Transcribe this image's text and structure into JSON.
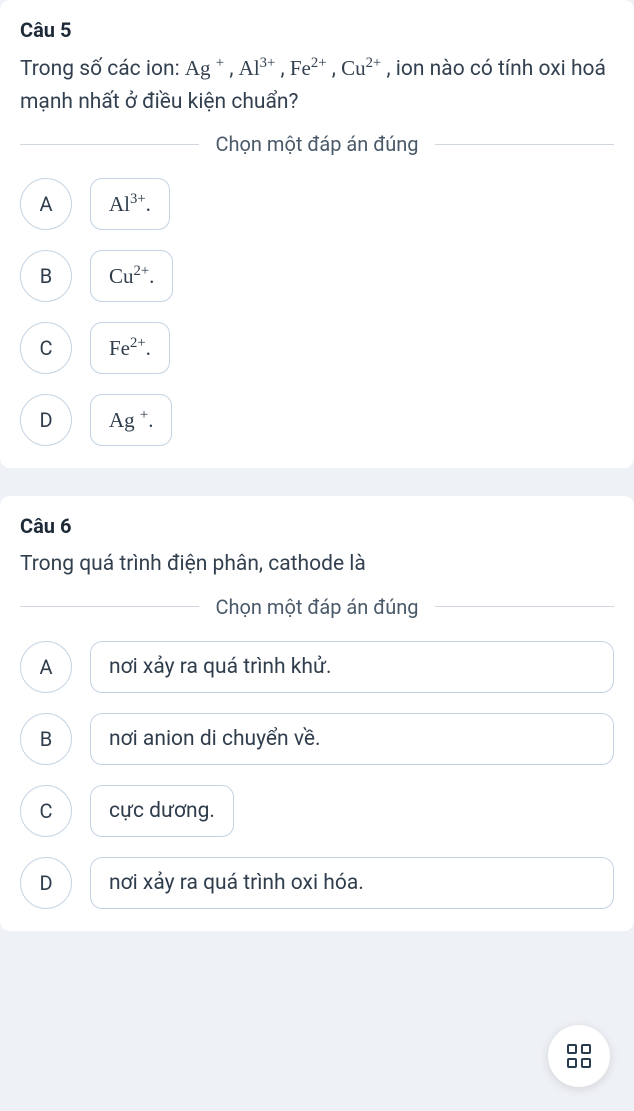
{
  "q5": {
    "title": "Câu 5",
    "stem_prefix": "Trong số các ion: ",
    "stem_suffix": ", ion nào có tính oxi hoá mạnh nhất ở điều kiện chuẩn?",
    "ions": [
      {
        "base": "Ag",
        "charge": "+"
      },
      {
        "base": "Al",
        "charge": "3+"
      },
      {
        "base": "Fe",
        "charge": "2+"
      },
      {
        "base": "Cu",
        "charge": "2+"
      }
    ],
    "prompt": "Chọn một đáp án đúng",
    "options": [
      {
        "letter": "A",
        "base": "Al",
        "charge": "3+",
        "tail": "."
      },
      {
        "letter": "B",
        "base": "Cu",
        "charge": "2+",
        "tail": "."
      },
      {
        "letter": "C",
        "base": "Fe",
        "charge": "2+",
        "tail": "."
      },
      {
        "letter": "D",
        "base": "Ag",
        "charge": "+",
        "tail": "."
      }
    ]
  },
  "q6": {
    "title": "Câu 6",
    "stem": "Trong quá trình điện phân, cathode là",
    "prompt": "Chọn một đáp án đúng",
    "options": [
      {
        "letter": "A",
        "text": "nơi xảy ra quá trình khử."
      },
      {
        "letter": "B",
        "text": "nơi anion di chuyển về."
      },
      {
        "letter": "C",
        "text": "cực dương."
      },
      {
        "letter": "D",
        "text": "nơi xảy ra quá trình oxi hóa."
      }
    ]
  },
  "fab": {
    "name": "grid-menu"
  }
}
